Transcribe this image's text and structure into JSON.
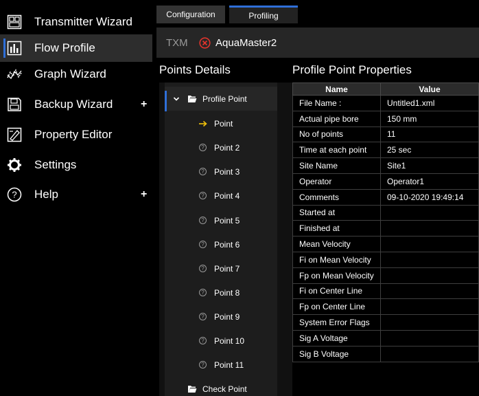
{
  "nav": {
    "items": [
      {
        "label": "Transmitter Wizard",
        "icon": "transmitter-icon",
        "active": false,
        "plus": false
      },
      {
        "label": "Flow Profile",
        "icon": "flow-profile-icon",
        "active": true,
        "plus": false
      },
      {
        "label": "Graph Wizard",
        "icon": "graph-icon",
        "active": false,
        "plus": false
      },
      {
        "label": "Backup Wizard",
        "icon": "backup-icon",
        "active": false,
        "plus": true
      },
      {
        "label": "Property Editor",
        "icon": "property-editor-icon",
        "active": false,
        "plus": false
      },
      {
        "label": "Settings",
        "icon": "gear-icon",
        "active": false,
        "plus": false
      },
      {
        "label": "Help",
        "icon": "help-icon",
        "active": false,
        "plus": true
      }
    ],
    "plus_label": "+"
  },
  "tabs": {
    "configuration": "Configuration",
    "profiling": "Profiling"
  },
  "txm": {
    "label": "TXM",
    "name": "AquaMaster2",
    "status_color": "#e0342c"
  },
  "points": {
    "header": "Points Details",
    "root_label": "Profile Point",
    "items": [
      "Point",
      "Point 2",
      "Point 3",
      "Point 4",
      "Point 5",
      "Point 6",
      "Point 7",
      "Point 8",
      "Point 9",
      "Point 10",
      "Point 11"
    ],
    "check_label": "Check Point"
  },
  "properties": {
    "header": "Profile Point Properties",
    "columns": [
      "Name",
      "Value"
    ],
    "rows": [
      [
        "File Name :",
        "Untitled1.xml"
      ],
      [
        "Actual pipe bore",
        "150 mm"
      ],
      [
        "No of points",
        "11"
      ],
      [
        "Time at each point",
        "25 sec"
      ],
      [
        "Site Name",
        "Site1"
      ],
      [
        "Operator",
        "Operator1"
      ],
      [
        "Comments",
        "09-10-2020 19:49:14"
      ],
      [
        "Started at",
        ""
      ],
      [
        "Finished at",
        ""
      ],
      [
        "Mean Velocity",
        ""
      ],
      [
        "Fi on Mean Velocity",
        ""
      ],
      [
        "Fp on Mean Velocity",
        ""
      ],
      [
        "Fi on Center Line",
        ""
      ],
      [
        "Fp on Center Line",
        ""
      ],
      [
        "System Error Flags",
        ""
      ],
      [
        "Sig A Voltage",
        ""
      ],
      [
        "Sig B Voltage",
        ""
      ]
    ]
  },
  "colors": {
    "accent": "#2f6fd8",
    "current_point": "#f2c20b"
  }
}
